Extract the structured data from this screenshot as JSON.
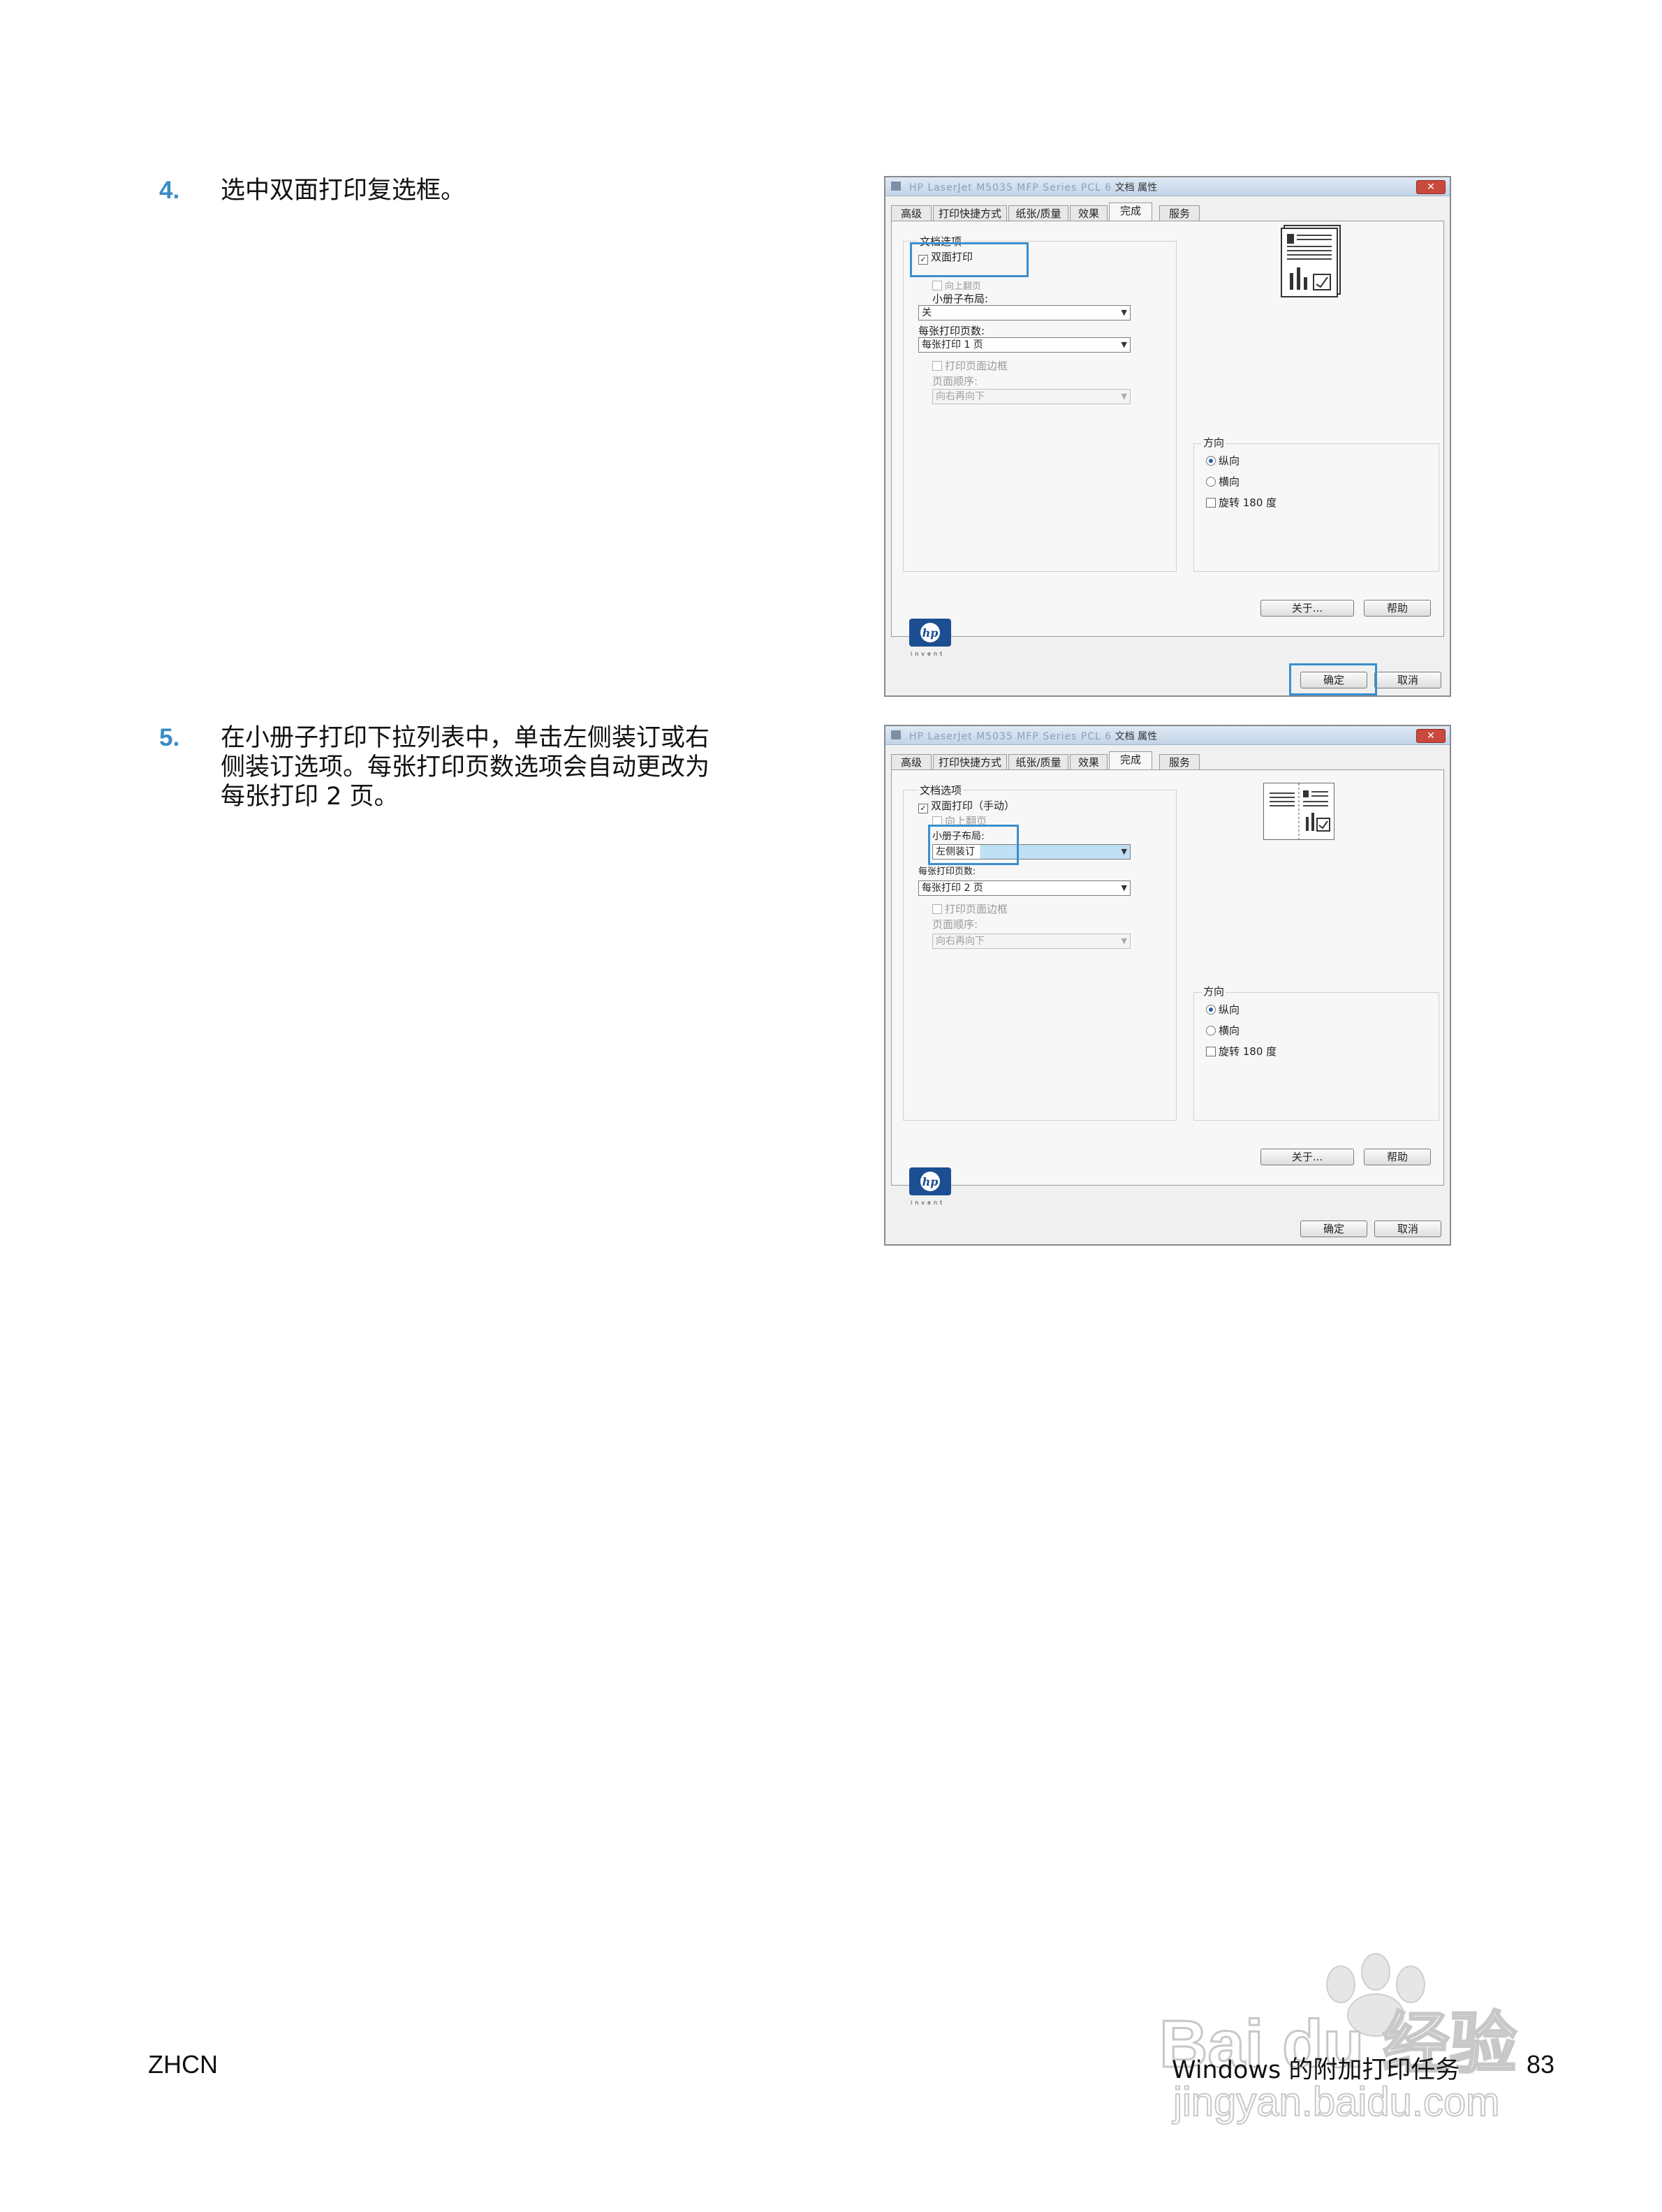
{
  "steps": [
    {
      "number": "4.",
      "lines": [
        "选中双面打印复选框。"
      ]
    },
    {
      "number": "5.",
      "lines": [
        "在小册子打印下拉列表中，单击左侧装订或右",
        "侧装订选项。每张打印页数选项会自动更改为",
        "每张打印 2 页。"
      ]
    }
  ],
  "dialogs": [
    {
      "title_blurred": "HP LaserJet M5035 MFP Series PCL 6",
      "title_suffix": "文档 属性",
      "tabs": [
        "高级",
        "打印快捷方式",
        "纸张/质量",
        "效果",
        "完成",
        "服务"
      ],
      "active_tab": "完成",
      "doc_options_label": "文档选项",
      "duplex_label": "双面打印",
      "duplex_checked": true,
      "flip_label": "向上翻页",
      "booklet_label": "小册子布局:",
      "booklet_value": "关",
      "pages_per_sheet_label": "每张打印页数:",
      "pages_per_sheet_value": "每张打印 1 页",
      "print_border_label": "打印页面边框",
      "page_order_label": "页面顺序:",
      "page_order_value": "向右再向下",
      "orientation_label": "方向",
      "portrait_label": "纵向",
      "landscape_label": "横向",
      "rotate_label": "旋转 180 度",
      "about_button": "关于...",
      "help_button": "帮助",
      "ok_button": "确定",
      "cancel_button": "取消",
      "logo_text": "invent"
    },
    {
      "title_blurred": "HP LaserJet M5035 MFP Series PCL 6",
      "title_suffix": "文档 属性",
      "tabs": [
        "高级",
        "打印快捷方式",
        "纸张/质量",
        "效果",
        "完成",
        "服务"
      ],
      "active_tab": "完成",
      "doc_options_label": "文档选项",
      "duplex_label": "双面打印（手动）",
      "duplex_checked": true,
      "flip_label": "向上翻页",
      "booklet_label": "小册子布局:",
      "booklet_value": "左侧装订",
      "pages_per_sheet_label": "每张打印页数:",
      "pages_per_sheet_value": "每张打印 2 页",
      "print_border_label": "打印页面边框",
      "page_order_label": "页面顺序:",
      "page_order_value": "向右再向下",
      "orientation_label": "方向",
      "portrait_label": "纵向",
      "landscape_label": "横向",
      "rotate_label": "旋转 180 度",
      "about_button": "关于...",
      "help_button": "帮助",
      "ok_button": "确定",
      "cancel_button": "取消",
      "logo_text": "invent"
    }
  ],
  "footer": {
    "left": "ZHCN",
    "right_title": "Windows 的附加打印任务",
    "page_number": "83"
  },
  "watermark": {
    "brand": "Bai du 经验",
    "url": "jingyan.baidu.com"
  },
  "colors": {
    "step_number": "#3a8bc5",
    "highlight": "#3a8fd0"
  }
}
